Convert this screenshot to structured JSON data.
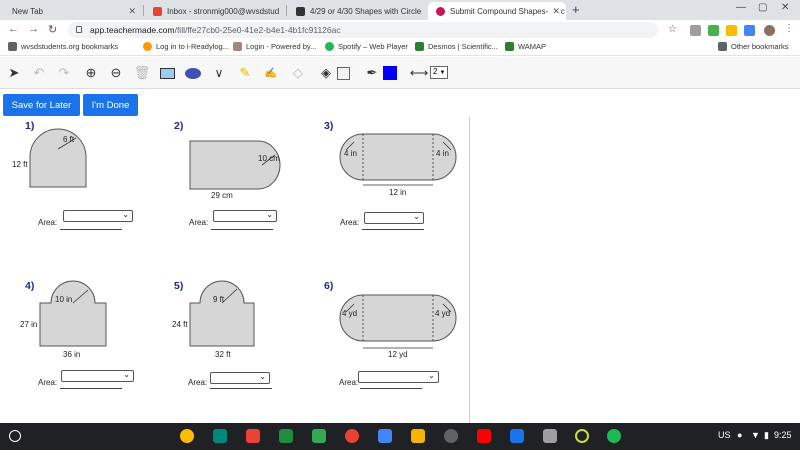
{
  "tabs": [
    {
      "label": "New Tab"
    },
    {
      "label": "Inbox - stronmig000@wvsdstud"
    },
    {
      "label": "4/29 or 4/30 Shapes with Circle"
    },
    {
      "label": "Submit Compound Shapes- Circ"
    }
  ],
  "url": {
    "host": "app.teachermade.com",
    "path": "/fill/ffe27cb0-25e0-41e2-b4e1-4b1fc91126ac"
  },
  "bookmarks": [
    {
      "label": "wvsdstudents.org bookmarks"
    },
    {
      "label": "Log in to i-Readylog..."
    },
    {
      "label": "Login - Powered by..."
    },
    {
      "label": "Spotify – Web Player"
    },
    {
      "label": "Desmos | Scientific..."
    },
    {
      "label": "WAMAP"
    },
    {
      "label": "Other bookmarks"
    }
  ],
  "toolbar": {
    "stroke_width": "2"
  },
  "actions": {
    "save_label": "Save for Later",
    "done_label": "I'm Done"
  },
  "problems": [
    {
      "number": "1)",
      "dims": [
        "6 ft",
        "12 ft"
      ],
      "area_label": "Area:"
    },
    {
      "number": "2)",
      "dims": [
        "10 cm",
        "29 cm"
      ],
      "area_label": "Area:"
    },
    {
      "number": "3)",
      "dims": [
        "4 in",
        "4 in",
        "12 in"
      ],
      "area_label": "Area:"
    },
    {
      "number": "4)",
      "dims": [
        "10 in",
        "27 in",
        "36 in"
      ],
      "area_label": "Area:"
    },
    {
      "number": "5)",
      "dims": [
        "9 ft",
        "24 ft",
        "32 ft"
      ],
      "area_label": "Area:"
    },
    {
      "number": "6)",
      "dims": [
        "4 yd",
        "4 yd",
        "12 yd"
      ],
      "area_label": "Area:"
    }
  ],
  "status": {
    "region": "US",
    "time": "9:25"
  },
  "colors": {
    "accent": "#1a73e8",
    "shape_fill": "#d6d6d6",
    "question_number": "#1c2a9c",
    "shelf": "#202124"
  }
}
